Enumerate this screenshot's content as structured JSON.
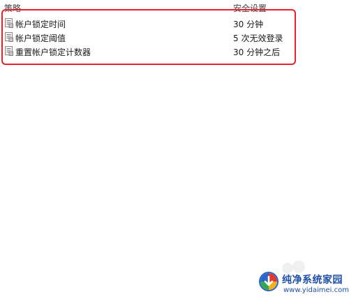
{
  "table": {
    "columns": {
      "policy": "策略",
      "setting": "安全设置"
    },
    "rows": [
      {
        "icon": "policy-document-icon",
        "name": "帐户锁定时间",
        "value": "30 分钟"
      },
      {
        "icon": "policy-document-icon",
        "name": "帐户锁定阈值",
        "value": "5 次无效登录"
      },
      {
        "icon": "policy-document-icon",
        "name": "重置帐户锁定计数器",
        "value": "30 分钟之后"
      }
    ]
  },
  "annotation": {
    "highlight_color": "#e8202a"
  },
  "watermark": {
    "title": "纯净系统家园",
    "url": "www.yidaimei.com",
    "brand_color": "#1f4fa8"
  }
}
